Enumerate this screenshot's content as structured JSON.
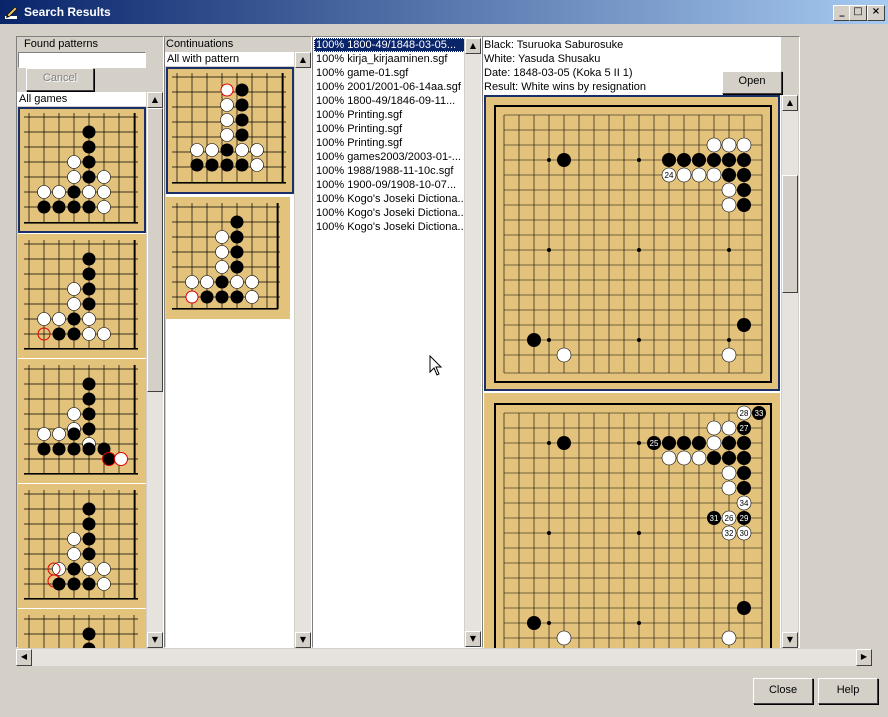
{
  "window": {
    "title": "Search Results",
    "minimize": "_",
    "maximize": "□",
    "close": "×"
  },
  "found_patterns": {
    "label": "Found patterns",
    "cancel_label": "Cancel",
    "scope_label": "All games"
  },
  "continuations": {
    "label": "Continuations",
    "filter_label": "All with pattern"
  },
  "games": [
    "100% 1800-49/1848-03-05...",
    "100% kirja_kirjaaminen.sgf",
    "100% game-01.sgf",
    "100% 2001/2001-06-14aa.sgf",
    "100% 1800-49/1846-09-11...",
    "100% Printing.sgf",
    "100% Printing.sgf",
    "100% Printing.sgf",
    "100% games2003/2003-01-...",
    "100% 1988/1988-11-10c.sgf",
    "100% 1900-09/1908-10-07...",
    "100% Kogo's Joseki Dictiona...",
    "100% Kogo's Joseki Dictiona...",
    "100% Kogo's Joseki Dictiona..."
  ],
  "game_info": {
    "black": "Black: Tsuruoka Saburosuke",
    "white": "White: Yasuda Shusaku",
    "date": "Date: 1848-03-05 (Koka 5 II 1)",
    "result": "Result: White wins by resignation",
    "open_label": "Open"
  },
  "move_numbers": {
    "board1": [
      "24"
    ],
    "board2": [
      "28",
      "33",
      "27",
      "25",
      "34",
      "31",
      "26",
      "29",
      "32",
      "30"
    ]
  },
  "footer": {
    "close_label": "Close",
    "help_label": "Help"
  },
  "colors": {
    "board": "#e3c27b",
    "selection": "#0a246a",
    "ghost_move": "#e00000"
  },
  "icons": {
    "app": "pencil-icon",
    "scroll_up": "arrow-up-icon",
    "scroll_down": "arrow-down-icon",
    "scroll_left": "arrow-left-icon",
    "scroll_right": "arrow-right-icon"
  }
}
